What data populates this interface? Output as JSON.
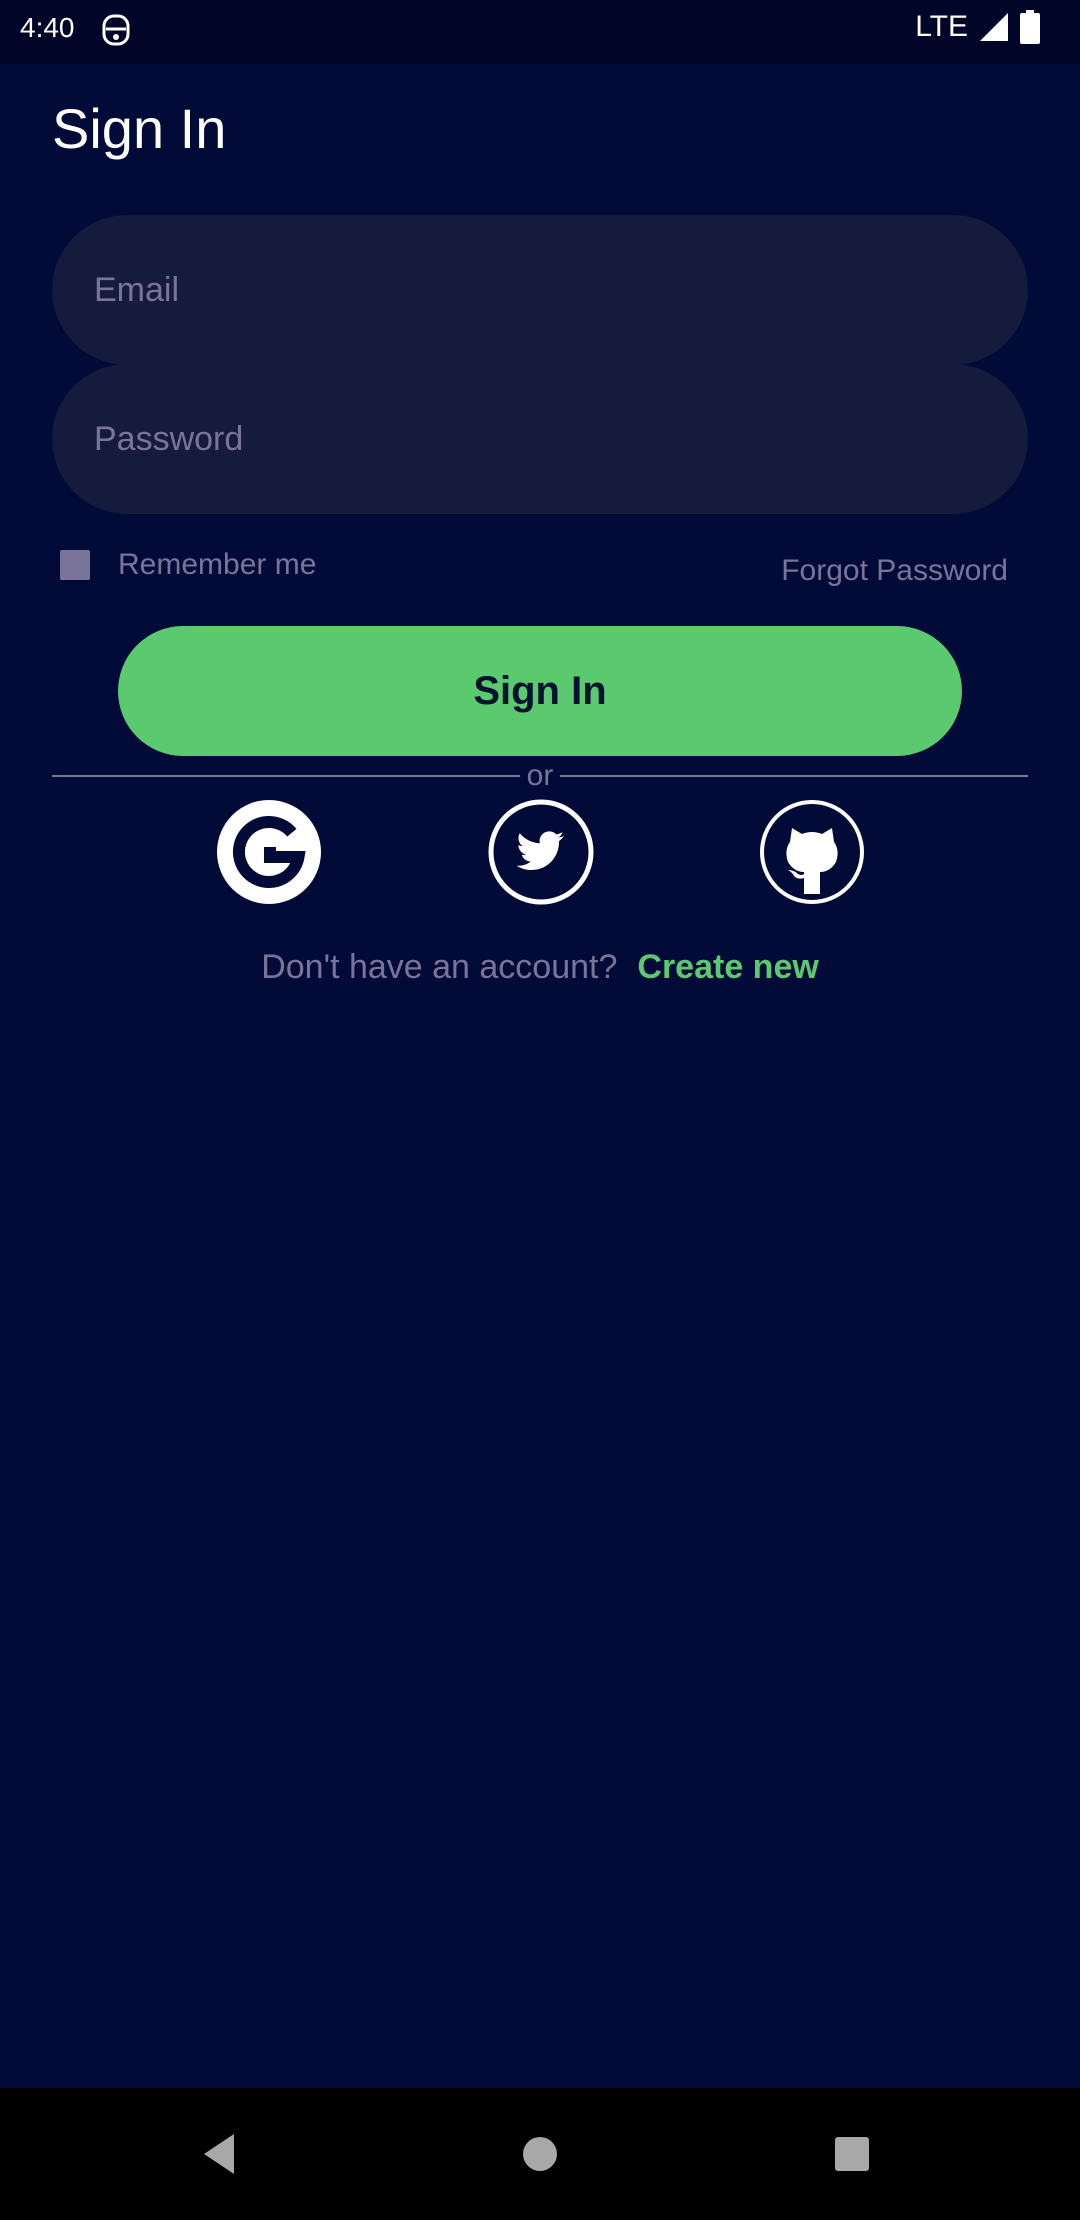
{
  "status_bar": {
    "time": "4:40",
    "network": "LTE",
    "icons": [
      "notification-app-icon",
      "signal-icon",
      "battery-icon"
    ]
  },
  "page": {
    "title": "Sign In"
  },
  "form": {
    "email_placeholder": "Email",
    "email_value": "",
    "password_placeholder": "Password",
    "password_value": "",
    "remember_label": "Remember me",
    "remember_checked": false,
    "forgot_label": "Forgot Password",
    "submit_label": "Sign In"
  },
  "divider": {
    "label": "or"
  },
  "social": {
    "providers": [
      "google-icon",
      "twitter-icon",
      "github-icon"
    ]
  },
  "signup": {
    "prompt": "Don't have an account?",
    "link": "Create new"
  },
  "nav_bar": {
    "buttons": [
      "back-icon",
      "home-icon",
      "recents-icon"
    ]
  },
  "colors": {
    "background": "#020b38",
    "status_bar": "#010629",
    "field_background": "#141b3c",
    "muted_text": "#7a749a",
    "accent": "#5bc96e",
    "button_text": "#021230"
  }
}
